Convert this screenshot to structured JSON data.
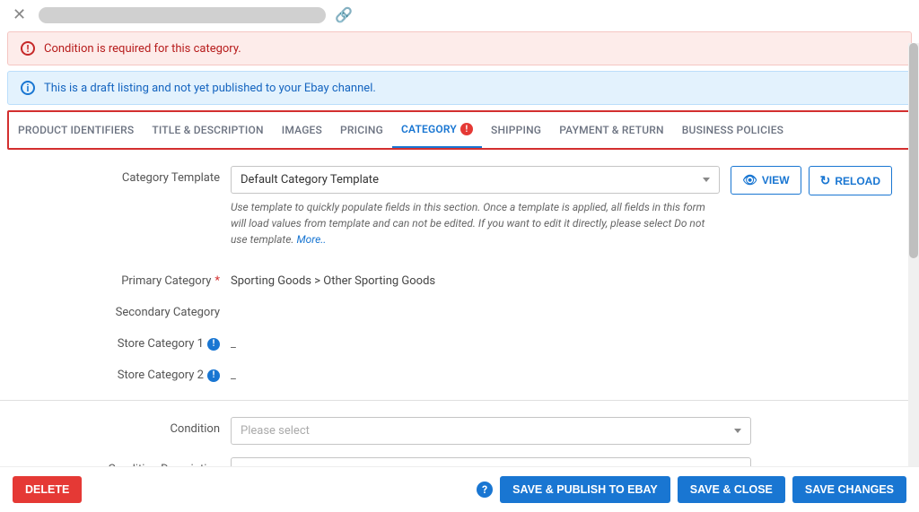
{
  "alerts": {
    "error": "Condition is required for this category.",
    "info": "This is a draft listing and not yet published to your Ebay channel."
  },
  "tabs": {
    "product_identifiers": "PRODUCT IDENTIFIERS",
    "title_description": "TITLE & DESCRIPTION",
    "images": "IMAGES",
    "pricing": "PRICING",
    "category": "CATEGORY",
    "shipping": "SHIPPING",
    "payment_return": "PAYMENT & RETURN",
    "business_policies": "BUSINESS POLICIES"
  },
  "form": {
    "category_template_label": "Category Template",
    "category_template_value": "Default Category Template",
    "helper_text": "Use template to quickly populate fields in this section. Once a template is applied, all fields in this form will load values from template and can not be edited. If you want to edit it directly, please select Do not use template. ",
    "helper_more": "More..",
    "view_btn": "VIEW",
    "reload_btn": "RELOAD",
    "primary_category_label": "Primary Category",
    "primary_category_value": "Sporting Goods > Other Sporting Goods",
    "secondary_category_label": "Secondary Category",
    "store_cat1_label": "Store Category 1",
    "store_cat1_value": "_",
    "store_cat2_label": "Store Category 2",
    "store_cat2_value": "_",
    "condition_label": "Condition",
    "condition_placeholder": "Please select",
    "condition_desc_label": "Condition Description"
  },
  "footer": {
    "delete": "DELETE",
    "save_publish": "SAVE & PUBLISH TO EBAY",
    "save_close": "SAVE & CLOSE",
    "save_changes": "SAVE CHANGES"
  }
}
